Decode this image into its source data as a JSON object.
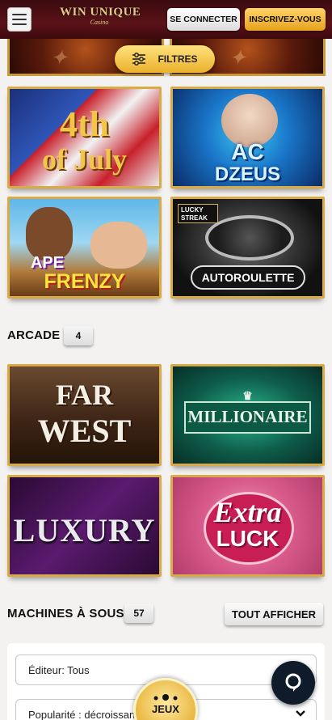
{
  "header": {
    "menu_icon": "hamburger-icon",
    "logo_main": "WIN UNIQUE",
    "logo_sub": "Casino",
    "login_label": "SE CONNECTER",
    "signup_label": "INSCRIVEZ-VOUS"
  },
  "filter": {
    "label": "FILTRES",
    "icon": "sliders-icon"
  },
  "top_games": [
    {
      "title_line1": "4th",
      "title_line2": "of July"
    },
    {
      "title_line1": "AC",
      "title_line2": "DZEUS"
    },
    {
      "title_line1": "APE",
      "title_line2": "FRENZY"
    },
    {
      "title_line1": "AUTOROULETTE",
      "badge_line1": "LUCKY",
      "badge_line2": "STREAK"
    }
  ],
  "arcade": {
    "title": "ARCADE",
    "count": "4",
    "games": [
      {
        "title_line1": "FAR",
        "title_line2": "WEST"
      },
      {
        "title_line1": "MILLIONAIRE"
      },
      {
        "title_line1": "LUXURY"
      },
      {
        "title_line1": "Extra",
        "title_line2": "LUCK"
      }
    ]
  },
  "slots": {
    "title": "MACHINES À SOUS",
    "count": "57",
    "show_all_label": "TOUT AFFICHER"
  },
  "filters_panel": {
    "editor_value": "Éditeur: Tous",
    "sort_value": "Popularité : décroissant"
  },
  "bottom": {
    "games_label": "JEUX",
    "chat_icon": "chat-icon"
  },
  "colors": {
    "gold": "#e6a21c",
    "header_bg": "#4a0e14",
    "chat_bg": "#0f1a2b"
  }
}
